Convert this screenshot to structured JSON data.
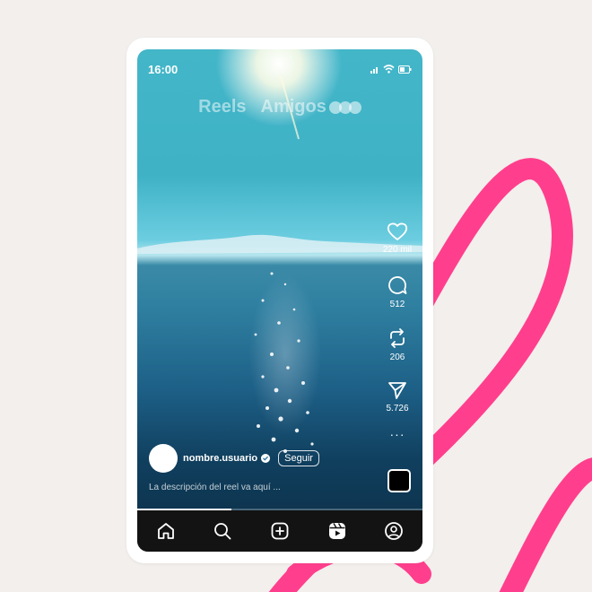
{
  "status_bar": {
    "time": "16:00"
  },
  "top_tabs": [
    {
      "label": "Reels"
    },
    {
      "label": "Amigos"
    }
  ],
  "actions": {
    "like": {
      "icon": "heart-icon",
      "count": "220 mil"
    },
    "comment": {
      "icon": "comment-icon",
      "count": "512"
    },
    "repost": {
      "icon": "repost-icon",
      "count": "206"
    },
    "share": {
      "icon": "send-icon",
      "count": "5.726"
    },
    "more": {
      "icon": "more-icon",
      "label": "···"
    }
  },
  "author": {
    "username": "nombre.usuario",
    "follow_label": "Seguir",
    "verified": true
  },
  "caption": "La descripción del reel va aquí ...",
  "progress": 0.33,
  "nav": [
    "home-icon",
    "search-icon",
    "create-icon",
    "reels-icon",
    "profile-icon"
  ],
  "colors": {
    "accent_swirl": "#ff3f8d",
    "background": "#f2efec",
    "nav_bg": "#131313"
  }
}
